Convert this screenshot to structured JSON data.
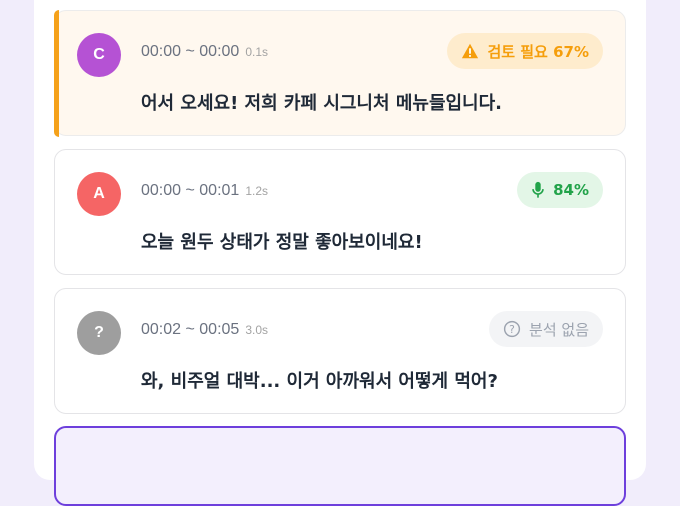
{
  "segments": [
    {
      "avatar": "C",
      "avatar_color": "#b552d4",
      "time_range": "00:00 ~ 00:00",
      "duration": "0.1s",
      "badge": {
        "type": "warning",
        "icon": "warning-icon",
        "label": "검토 필요 67%",
        "color": "#f59e0b"
      },
      "text": "어서 오세요! 저희 카페 시그니처 메뉴들입니다."
    },
    {
      "avatar": "A",
      "avatar_color": "#f56565",
      "time_range": "00:00 ~ 00:01",
      "duration": "1.2s",
      "badge": {
        "type": "confidence",
        "icon": "microphone-icon",
        "label": "84%",
        "color": "#22a34a"
      },
      "text": "오늘 원두 상태가 정말 좋아보이네요!"
    },
    {
      "avatar": "?",
      "avatar_color": "#9e9e9e",
      "time_range": "00:02 ~ 00:05",
      "duration": "3.0s",
      "badge": {
        "type": "none",
        "icon": "question-circle-icon",
        "label": "분석 없음",
        "color": "#9ca3af"
      },
      "text": "와, 비주얼 대박... 이거 아까워서 어떻게 먹어?"
    }
  ]
}
